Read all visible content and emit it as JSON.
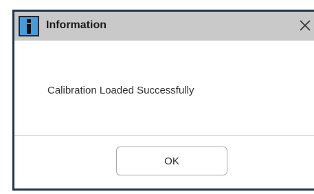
{
  "dialog": {
    "title": "Information",
    "icon": "info-icon",
    "close_icon": "close-icon",
    "message": "Calibration Loaded Successfully",
    "ok_label": "OK"
  },
  "colors": {
    "titlebar": "#c9c9c9",
    "border": "#1e3548",
    "icon_background": "#4a9ad6"
  }
}
